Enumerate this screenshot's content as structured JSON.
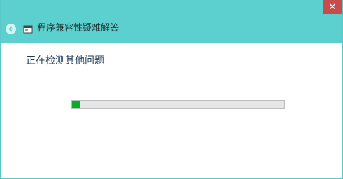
{
  "window": {
    "title": "程序兼容性疑难解答",
    "close_glyph": "✕",
    "back_icon": "back-arrow-icon",
    "app_icon": "troubleshooter-icon"
  },
  "main": {
    "status_text": "正在检测其他问题",
    "progress": {
      "fraction": 0.035
    }
  },
  "colors": {
    "titlebar": "#5ccfcf",
    "close_button": "#c74b4b",
    "progress_fill": "#06b025",
    "progress_track": "#e6e6e6"
  }
}
